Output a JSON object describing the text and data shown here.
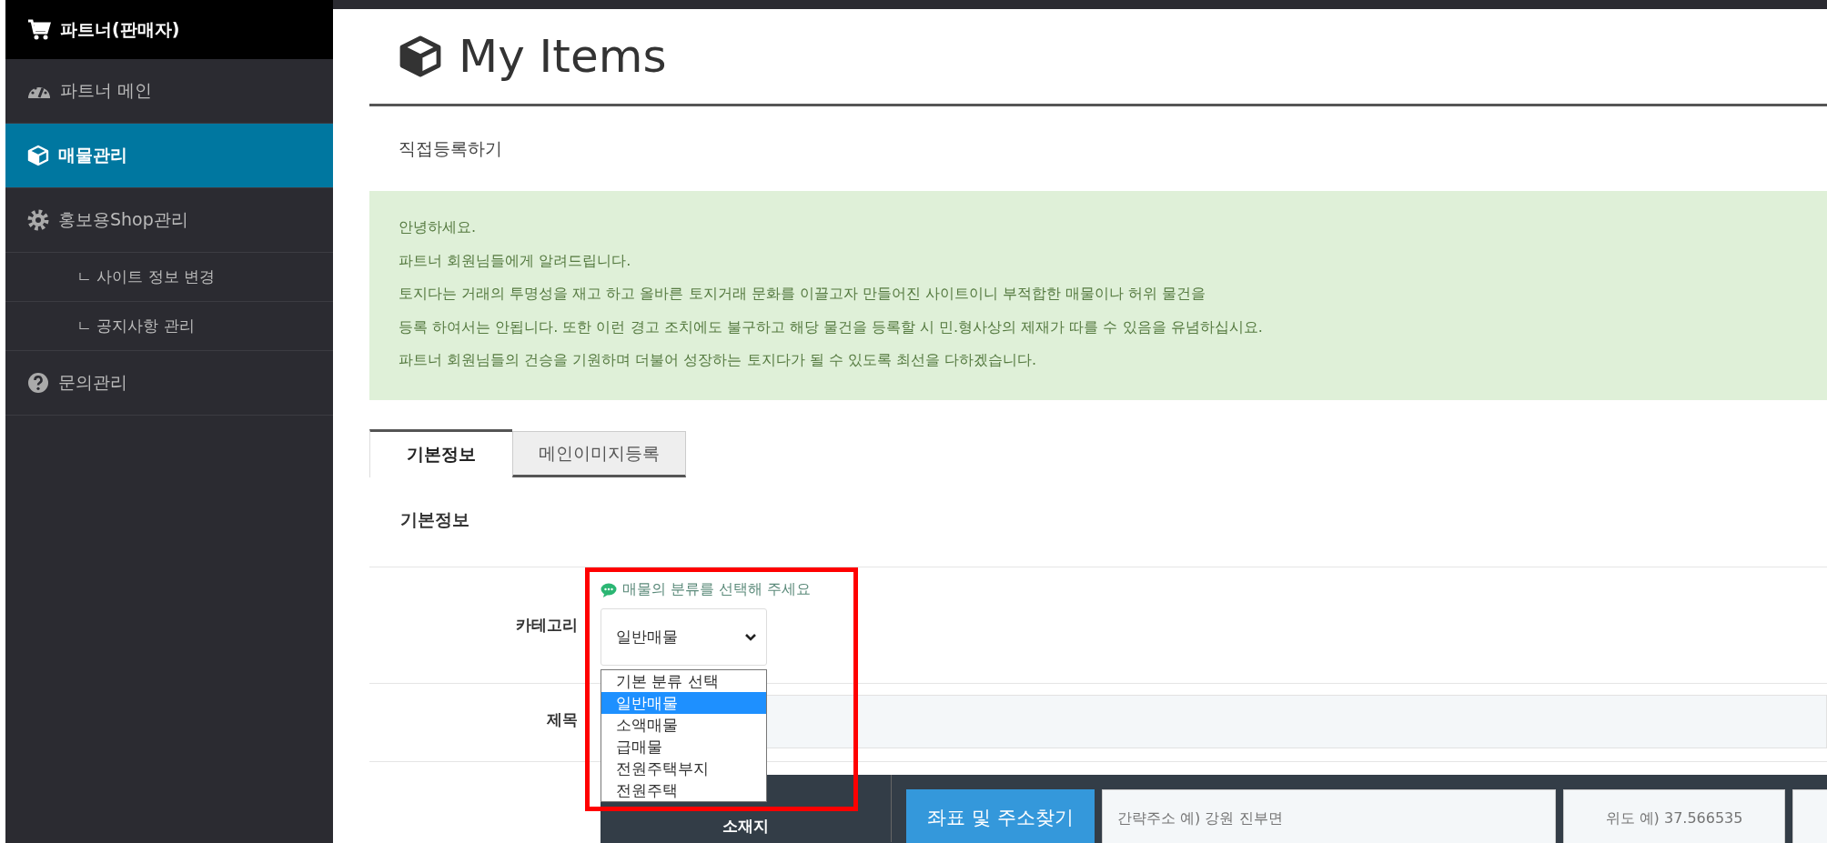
{
  "sidebar": {
    "header": "파트너(판매자)",
    "items": [
      {
        "kind": "menu",
        "label": "파트너 메인",
        "selected": false
      },
      {
        "kind": "menu",
        "label": "매물관리",
        "selected": true
      },
      {
        "kind": "menu",
        "label": "홍보용Shop관리",
        "selected": false
      },
      {
        "kind": "submenu",
        "label": "ㄴ 사이트 정보 변경",
        "selected": false
      },
      {
        "kind": "submenu",
        "label": "ㄴ 공지사항 관리",
        "selected": false
      },
      {
        "kind": "menu",
        "label": "문의관리",
        "selected": false
      }
    ]
  },
  "page": {
    "title": "My Items",
    "subtitle": "직접등록하기"
  },
  "notice": [
    "안녕하세요.",
    "파트너 회원님들에게 알려드립니다.",
    "토지다는 거래의 투명성을 재고 하고 올바른 토지거래 문화를 이끌고자 만들어진 사이트이니 부적합한 매물이나 허위 물건을",
    "등록 하여서는 안됩니다. 또한 이런 경고 조치에도 불구하고 해당 물건을 등록할 시 민.형사상의 제재가 따를 수 있음을 유념하십시요.",
    "파트너 회원님들의 건승을 기원하며 더불어 성장하는 토지다가 될 수 있도록 최선을 다하겠습니다."
  ],
  "tabs": [
    {
      "label": "기본정보",
      "selected": true
    },
    {
      "label": "메인이미지등록",
      "selected": false
    }
  ],
  "section_title": "기본정보",
  "form": {
    "category": {
      "label": "카테고리",
      "hint": "매물의 분류를 선택해 주세요",
      "value": "일반매물",
      "expanded": true,
      "options": [
        {
          "label": "기본 분류 선택",
          "selected": false
        },
        {
          "label": "일반매물",
          "selected": true
        },
        {
          "label": "소액매물",
          "selected": false
        },
        {
          "label": "급매물",
          "selected": false
        },
        {
          "label": "전원주택부지",
          "selected": false
        },
        {
          "label": "전원주택",
          "selected": false
        }
      ]
    },
    "title_field": {
      "label": "제목"
    },
    "location": {
      "label": "소재지",
      "button": "좌표 및 주소찾기",
      "address_placeholder": "간략주소 예) 강원 진부면",
      "latitude_placeholder": "위도 예) 37.566535"
    }
  },
  "highlight_frame": true
}
